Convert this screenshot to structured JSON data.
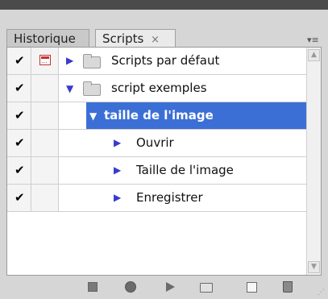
{
  "tabs": [
    {
      "label": "Historique",
      "active": false
    },
    {
      "label": "Scripts",
      "close_glyph": "×",
      "active": true
    }
  ],
  "icons": {
    "collapse": "double-chevron-right-icon",
    "panel_menu": "panel-menu-icon",
    "checkmark": "✔",
    "expand_collapsed": "▶",
    "expand_open": "▼"
  },
  "rows": [
    {
      "checked": true,
      "dialog_toggle": true,
      "expanded": false,
      "type": "set",
      "label": "Scripts par défaut"
    },
    {
      "checked": true,
      "dialog_toggle": false,
      "expanded": true,
      "type": "set",
      "label": "script exemples"
    },
    {
      "checked": true,
      "dialog_toggle": false,
      "expanded": true,
      "type": "action",
      "label": "taille de l'image",
      "selected": true
    },
    {
      "checked": true,
      "dialog_toggle": false,
      "expanded": false,
      "type": "command",
      "label": "Ouvrir"
    },
    {
      "checked": true,
      "dialog_toggle": false,
      "expanded": false,
      "type": "command",
      "label": "Taille de l'image"
    },
    {
      "checked": true,
      "dialog_toggle": false,
      "expanded": false,
      "type": "command",
      "label": "Enregistrer"
    }
  ],
  "colors": {
    "selection": "#3c6fd6",
    "triangle": "#3a3acb",
    "dialog_toggle": "#c23030"
  },
  "toolbar": [
    "stop",
    "record",
    "play",
    "new-set",
    "new-action",
    "delete"
  ]
}
